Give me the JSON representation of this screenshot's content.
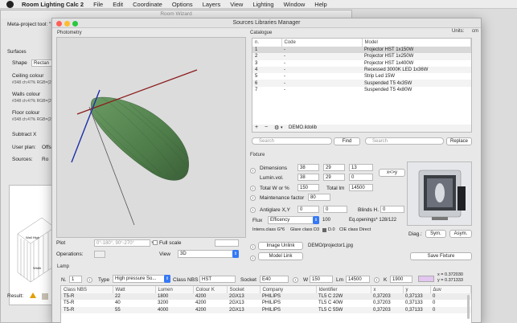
{
  "menubar": {
    "app": "Room Lighting Calc 2",
    "items": [
      "File",
      "Edit",
      "Coordinate",
      "Options",
      "Layers",
      "View",
      "Lighting",
      "Window",
      "Help"
    ]
  },
  "room_wizard": {
    "title": "Room Wizard",
    "meta_project_tool": "Meta-project tool: \"F",
    "surfaces_label": "Surfaces",
    "shape_label": "Shape",
    "shape_value": "Rectan",
    "ceiling_label": "Ceiling colour",
    "ceiling_sub": "#348 ch:47% RGB=(2",
    "walls_label": "Walls colour",
    "walls_sub": "#348 ch:47% RGB=(2",
    "floor_label": "Floor colour",
    "floor_sub": "#348 ch:47% RGB=(2",
    "subtract_label": "Subtract X",
    "user_plan_label": "User plan:",
    "user_plan_value": "Offs",
    "sources_label": "Sources:",
    "sources_value": "Ro",
    "diagram_wall_high": "Wall High",
    "diagram_width": "Width",
    "result_label": "Result:"
  },
  "slm": {
    "title": "Sources Libraries Manager",
    "photometry_label": "Photometry",
    "catalogue_label": "Catalogue",
    "units_label": "Units:",
    "units_value": "cm",
    "catalogue": {
      "columns": [
        "n.",
        "Code",
        "Model"
      ],
      "rows": [
        [
          "1",
          "-",
          "Projector HST 1x150W"
        ],
        [
          "2",
          "-",
          "Projector HST 1x250W"
        ],
        [
          "3",
          "-",
          "Projector HST 1x400W"
        ],
        [
          "4",
          "-",
          "Recessed 3000K LED 1x36W"
        ],
        [
          "5",
          "-",
          "Strip Led 15W"
        ],
        [
          "6",
          "-",
          "Suspended T5  4x35W"
        ],
        [
          "7",
          "-",
          "Suspended T5  4x80W"
        ]
      ],
      "library_file": "DEMO.ildolib",
      "search_placeholder": "Search",
      "find_label": "Find",
      "search2_placeholder": "Search",
      "replace_label": "Replace"
    },
    "plot_label": "Plot",
    "plot_value": "0°-180°, 90°-270°",
    "full_scale_label": "Full scale",
    "operations_label": "Operations:",
    "view_label": "View",
    "view_value": "3D",
    "fixture": {
      "label": "Fixture",
      "dimensions_label": "Dimensions",
      "dimensions": [
        "38",
        "29",
        "13"
      ],
      "lumin_vol_label": "Lumin.vol.",
      "lumin_vol": [
        "38",
        "29",
        "0"
      ],
      "swap_label": "x<>y",
      "total_w_label": "Total W or %",
      "total_w_value": "150",
      "total_lm_label": "Total lm",
      "total_lm_value": "14500",
      "maint_label": "Maintenance factor",
      "maint_value": "80",
      "antiglare_label": "Antiglare X,Y",
      "antiglare": [
        "0",
        "0"
      ],
      "blinds_label": "Blinds H.",
      "blinds_value": "0",
      "flux_label": "Flux",
      "flux_value": "Efficency",
      "flux_number": "100",
      "eq_openings": "Eq.openings* 128/122",
      "intens_class": "Intens.class G*6",
      "glare_class": "Glare class D3",
      "d_value": "D.0",
      "cie_class": "CIE class Direct",
      "diag_label": "Diag.:",
      "sym_label": "Sym.",
      "asym_label": "Asym.",
      "image_unlink": "Image Unlink",
      "image_path": "DEMO/projector1.jpg",
      "model_link": "Model Link",
      "save_fixture": "Save Fixture"
    },
    "lamp": {
      "label": "Lamp",
      "n_label": "N.",
      "n_value": "1",
      "type_label": "Type",
      "type_value": "High pressure So...",
      "class_nbs_label": "Class NBS",
      "class_nbs_value": "HST",
      "socket_label": "Socket",
      "socket_value": "E40",
      "w_label": "W",
      "w_value": "150",
      "lm_label": "Lm",
      "lm_value": "14500",
      "k_label": "K",
      "k_value": "1900",
      "x_coord": "x = 0.372030",
      "y_coord": "y = 0.371333",
      "columns": [
        "Class NBS",
        "Watt",
        "Lumen",
        "Colour K",
        "Socket",
        "Company",
        "Identifier",
        "x",
        "y",
        "Δuv"
      ],
      "rows": [
        [
          "T5-R",
          "22",
          "1800",
          "4200",
          "2GX13",
          "PHILIPS",
          "TL5 C 22W",
          "0,37203",
          "0,37133",
          "0"
        ],
        [
          "T5-R",
          "40",
          "3200",
          "4200",
          "2GX13",
          "PHILIPS",
          "TL5 C 40W",
          "0,37203",
          "0,37133",
          "0"
        ],
        [
          "T5-R",
          "55",
          "4000",
          "4200",
          "2GX13",
          "PHILIPS",
          "TL5 C 55W",
          "0,37203",
          "0,37133",
          "0"
        ]
      ]
    }
  },
  "colors": {
    "accent": "#3478f6",
    "lamp_swatch": "#e3c6f0",
    "ceiling_swatch": "#d8d4c8"
  }
}
